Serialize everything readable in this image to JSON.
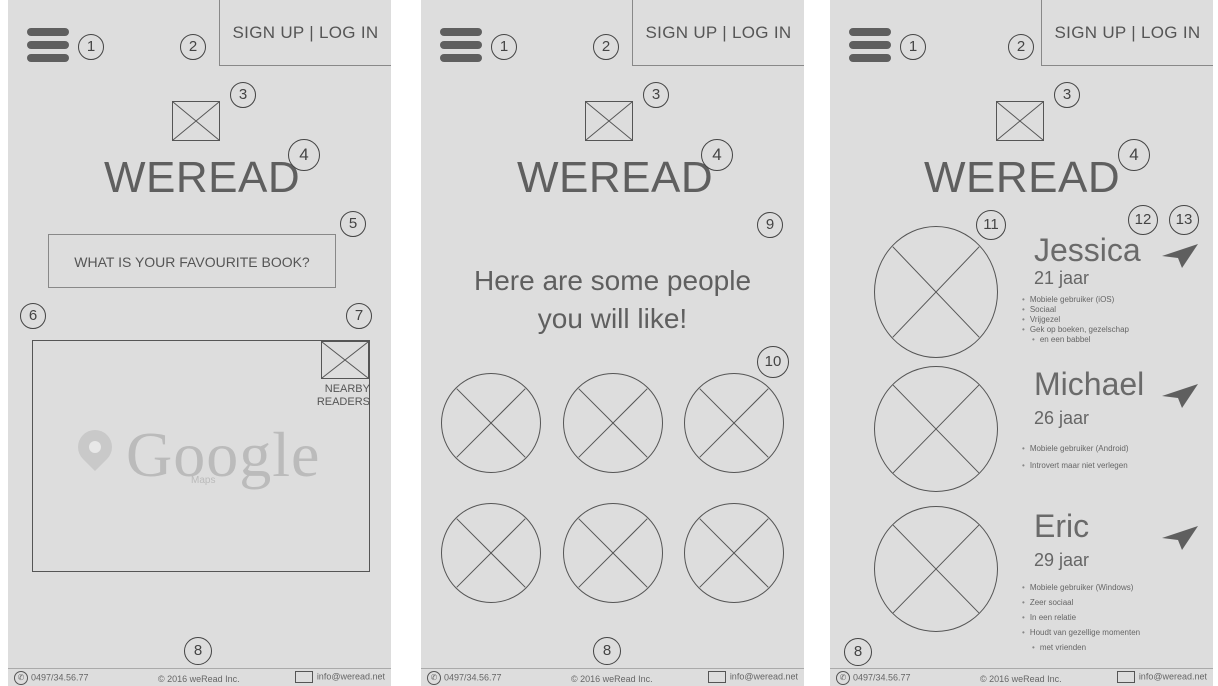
{
  "header": {
    "signup_login": "SIGN UP | LOG IN",
    "logo_text": "WEREAD"
  },
  "annotations": {
    "n1": "1",
    "n2": "2",
    "n3": "3",
    "n4": "4",
    "n5": "5",
    "n6": "6",
    "n7": "7",
    "n8": "8",
    "n9": "9",
    "n10": "10",
    "n11": "11",
    "n12": "12",
    "n13": "13"
  },
  "screen1": {
    "search_text": "WHAT IS YOUR FAVOURITE BOOK?",
    "map_brand": "Google",
    "map_sub": "Maps",
    "nearby_line1": "NEARBY",
    "nearby_line2": "READERS"
  },
  "screen2": {
    "headline_line1": "Here are some people",
    "headline_line2": "you will like!"
  },
  "screen3": {
    "people": [
      {
        "name": "Jessica",
        "age": "21 jaar",
        "traits": [
          "Mobiele gebruiker (iOS)",
          "Sociaal",
          "Vrijgezel",
          "Gek op boeken, gezelschap",
          "en een babbel"
        ]
      },
      {
        "name": "Michael",
        "age": "26 jaar",
        "traits": [
          "Mobiele gebruiker (Android)",
          "Introvert maar niet verlegen"
        ]
      },
      {
        "name": "Eric",
        "age": "29 jaar",
        "traits": [
          "Mobiele gebruiker (Windows)",
          "Zeer sociaal",
          "In een relatie",
          "Houdt van gezellige momenten",
          "met vrienden"
        ]
      }
    ]
  },
  "footer": {
    "phone": "0497/34.56.77",
    "copyright": "© 2016 weRead Inc.",
    "email": "info@weread.net"
  },
  "icons": {
    "menu": "hamburger-menu-icon",
    "image_placeholder": "image-placeholder-icon",
    "phone": "phone-icon",
    "mail": "mail-icon",
    "send": "send-icon",
    "map_pin": "map-pin-icon"
  }
}
